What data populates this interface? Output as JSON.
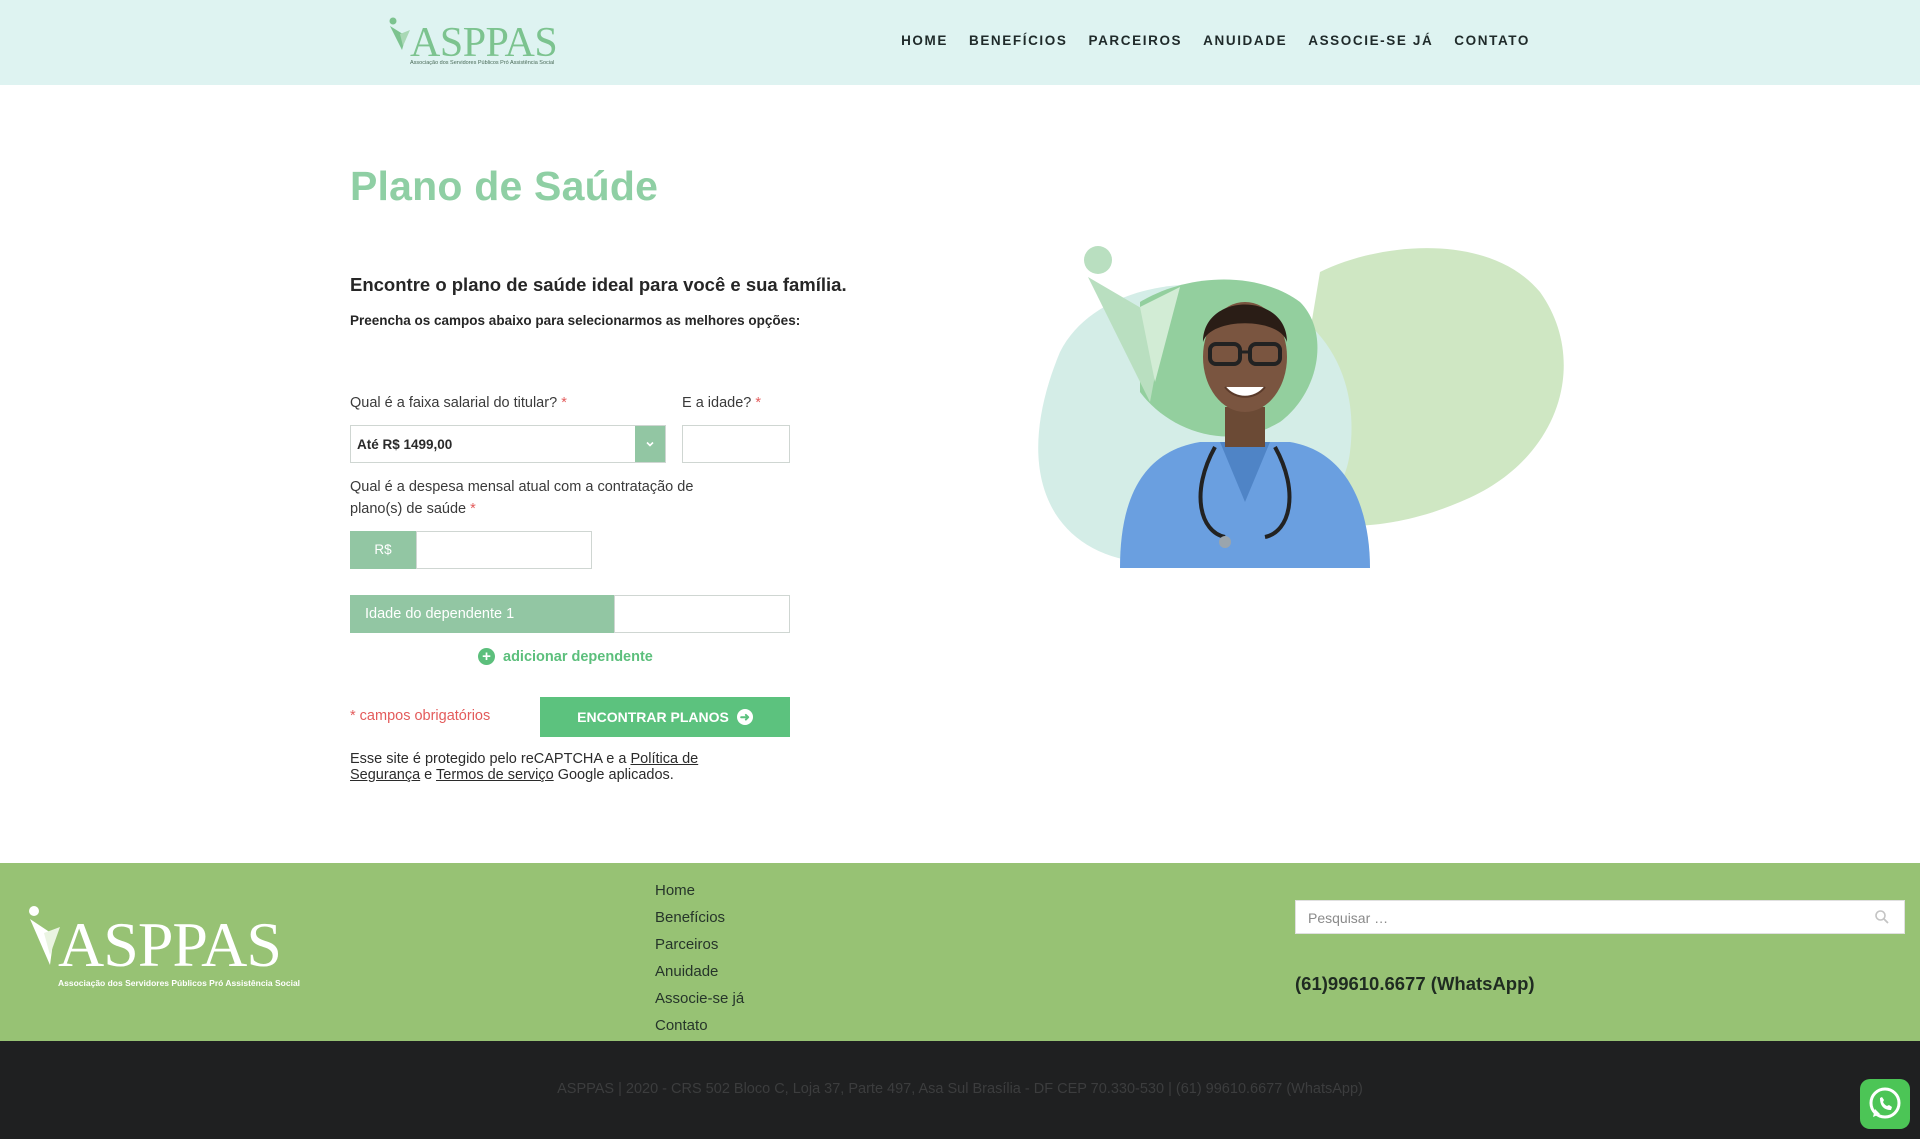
{
  "header": {
    "logo_text": "ASPPAS",
    "logo_subtitle": "Associação dos Servidores Públicos Pró Assistência Social",
    "nav": [
      "HOME",
      "BENEFÍCIOS",
      "PARCEIROS",
      "ANUIDADE",
      "ASSOCIE-SE JÁ",
      "CONTATO"
    ]
  },
  "main": {
    "title": "Plano de Saúde",
    "lead": "Encontre o plano de saúde ideal para você e sua família.",
    "sublead": "Preencha os campos abaixo para selecionarmos as melhores opções:",
    "salary_label": "Qual é a faixa salarial do titular?",
    "salary_value": "Até R$ 1499,00",
    "age_label": "E a idade?",
    "age_value": "",
    "expense_label_line1": "Qual é a despesa mensal atual com a contratação de",
    "expense_label_line2": "plano(s) de saúde",
    "expense_prefix": "R$",
    "expense_value": "",
    "dependent_label": "Idade do dependente 1",
    "dependent_value": "",
    "add_dependent": "adicionar dependente",
    "required_marker": "*",
    "required_note": "* campos obrigatórios",
    "find_button": "ENCONTRAR PLANOS",
    "recaptcha_prefix": "Esse site é protegido pelo reCAPTCHA e a",
    "privacy_link": "Política de Segurança",
    "recaptcha_and": "e",
    "terms_link": "Termos de serviço",
    "recaptcha_suffix": "Google aplicados."
  },
  "footer": {
    "logo_text": "ASPPAS",
    "logo_subtitle": "Associação dos Servidores Públicos Pró Assistência Social",
    "nav": [
      "Home",
      "Benefícios",
      "Parceiros",
      "Anuidade",
      "Associe-se já",
      "Contato"
    ],
    "search_placeholder": "Pesquisar …",
    "phone": "(61)99610.6677 (WhatsApp)",
    "copyright": "ASPPAS | 2020 - CRS 502 Bloco C, Loja 37, Parte 497, Asa Sul Brasília - DF CEP 70.330-530 | (61) 99610.6677 (WhatsApp)"
  },
  "colors": {
    "header_bg": "#def3f1",
    "accent_green": "#5cc27e",
    "muted_green": "#92c6a3",
    "footer_bg": "#97c274",
    "bottom_bar": "#1f2021",
    "required_red": "#e35b5b"
  },
  "icons": [
    "asppas-logo-mark-icon",
    "chevron-down-icon",
    "plus-circle-icon",
    "arrow-right-circle-icon",
    "search-icon",
    "whatsapp-icon"
  ]
}
